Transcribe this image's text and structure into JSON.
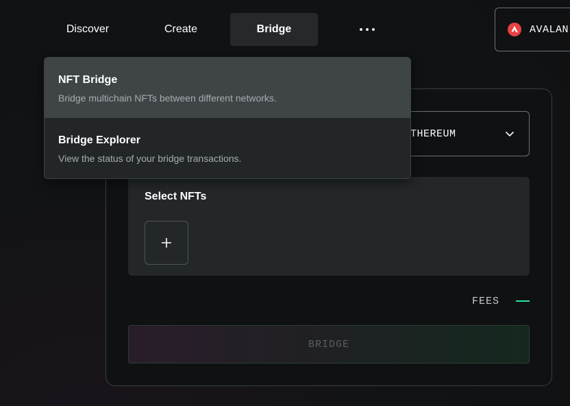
{
  "nav": {
    "items": [
      {
        "label": "Discover"
      },
      {
        "label": "Create"
      },
      {
        "label": "Bridge",
        "active": true
      }
    ],
    "more_icon": "ellipsis-icon"
  },
  "chain_button": {
    "label": "AVALAN",
    "icon": "avalanche-logo-icon",
    "icon_color": "#e84142"
  },
  "dropdown": {
    "items": [
      {
        "title": "NFT Bridge",
        "description": "Bridge multichain NFTs between different networks."
      },
      {
        "title": "Bridge Explorer",
        "description": "View the status of your bridge transactions."
      }
    ]
  },
  "bridge_form": {
    "destination_chain_label": "THEREUM",
    "chevron_icon": "chevron-down-icon",
    "select_nfts_title": "Select NFTs",
    "add_icon": "plus-icon",
    "fees_label": "FEES",
    "fees_value_color": "#30e3a0",
    "submit_label": "BRIDGE"
  }
}
